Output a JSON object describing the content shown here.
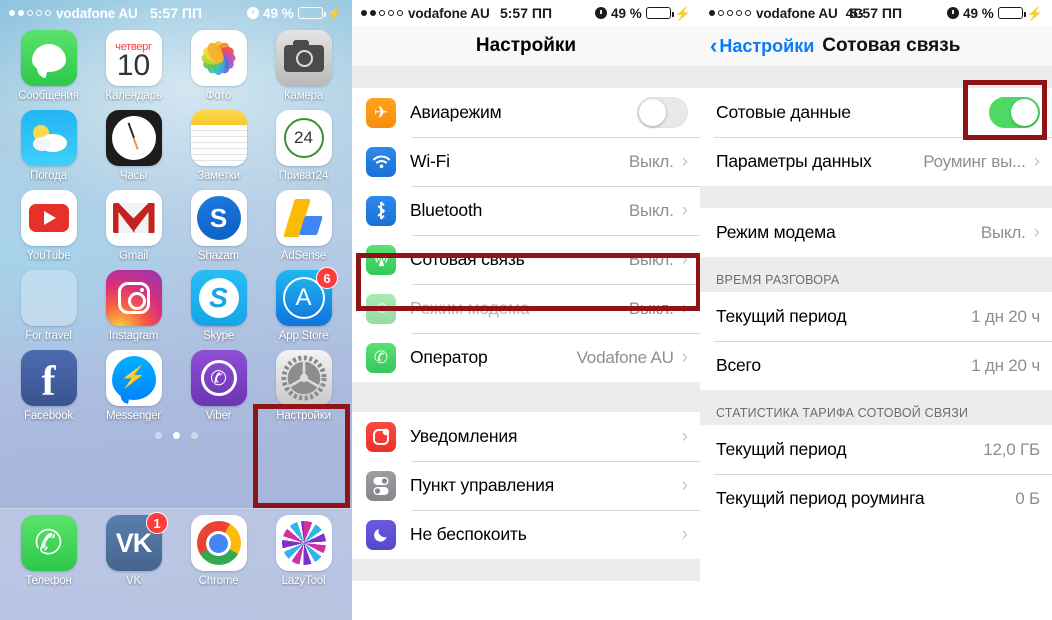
{
  "status_bars": {
    "home": {
      "dots_filled": 2,
      "dots_total": 5,
      "carrier": "vodafone AU",
      "network": "",
      "time": "5:57 ПП",
      "battery_pct": "49 %",
      "charging": true
    },
    "settings": {
      "dots_filled": 2,
      "dots_total": 5,
      "carrier": "vodafone AU",
      "network": "",
      "time": "5:57 ПП",
      "battery_pct": "49 %",
      "charging": true
    },
    "cellular": {
      "dots_filled": 1,
      "dots_total": 5,
      "carrier": "vodafone AU",
      "network": "4G",
      "time": "5:57 ПП",
      "battery_pct": "49 %",
      "charging": true
    }
  },
  "home_screen": {
    "rows": [
      [
        {
          "label": "Сообщения",
          "icon": "messages-icon"
        },
        {
          "label": "Календарь",
          "icon": "calendar-icon",
          "weekday": "четверг",
          "day": "10"
        },
        {
          "label": "Фото",
          "icon": "photos-icon"
        },
        {
          "label": "Камера",
          "icon": "camera-icon"
        }
      ],
      [
        {
          "label": "Погода",
          "icon": "weather-icon"
        },
        {
          "label": "Часы",
          "icon": "clock-icon"
        },
        {
          "label": "Заметки",
          "icon": "notes-icon"
        },
        {
          "label": "Приват24",
          "icon": "privat24-icon",
          "text": "24"
        }
      ],
      [
        {
          "label": "YouTube",
          "icon": "youtube-icon"
        },
        {
          "label": "Gmail",
          "icon": "gmail-icon"
        },
        {
          "label": "Shazam",
          "icon": "shazam-icon",
          "text": "S"
        },
        {
          "label": "AdSense",
          "icon": "adsense-icon"
        }
      ],
      [
        {
          "label": "For travel",
          "icon": "folder-icon"
        },
        {
          "label": "Instagram",
          "icon": "instagram-icon"
        },
        {
          "label": "Skype",
          "icon": "skype-icon",
          "text": "S"
        },
        {
          "label": "App Store",
          "icon": "appstore-icon",
          "badge": "6"
        }
      ],
      [
        {
          "label": "Facebook",
          "icon": "facebook-icon",
          "text": "f"
        },
        {
          "label": "Messenger",
          "icon": "messenger-icon"
        },
        {
          "label": "Viber",
          "icon": "viber-icon"
        },
        {
          "label": "Настройки",
          "icon": "settings-gear-icon",
          "highlighted": true
        }
      ]
    ],
    "page_dots": {
      "count": 3,
      "active_index": 1
    },
    "dock": [
      {
        "label": "Телефон",
        "icon": "phone-icon"
      },
      {
        "label": "VK",
        "icon": "vk-icon",
        "text": "VK",
        "badge": "1"
      },
      {
        "label": "Chrome",
        "icon": "chrome-icon"
      },
      {
        "label": "LazyTool",
        "icon": "lazytool-icon"
      }
    ]
  },
  "settings_screen": {
    "title": "Настройки",
    "group1": [
      {
        "label": "Авиарежим",
        "icon": "airplane-icon",
        "control": "toggle",
        "toggle_on": false
      },
      {
        "label": "Wi-Fi",
        "icon": "wifi-icon",
        "value": "Выкл.",
        "chevron": "›"
      },
      {
        "label": "Bluetooth",
        "icon": "bluetooth-icon",
        "value": "Выкл.",
        "chevron": "›"
      },
      {
        "label": "Сотовая связь",
        "icon": "cellular-icon",
        "value": "Выкл.",
        "chevron": "›",
        "highlighted": true
      },
      {
        "label": "Режим модема",
        "icon": "hotspot-icon",
        "value": "Выкл.",
        "chevron": "›",
        "dimmed": true
      },
      {
        "label": "Оператор",
        "icon": "carrier-phone-icon",
        "value": "Vodafone AU",
        "chevron": "›"
      }
    ],
    "group2": [
      {
        "label": "Уведомления",
        "icon": "notifications-icon",
        "chevron": "›"
      },
      {
        "label": "Пункт управления",
        "icon": "control-center-icon",
        "chevron": "›"
      },
      {
        "label": "Не беспокоить",
        "icon": "do-not-disturb-icon",
        "chevron": "›"
      }
    ]
  },
  "cellular_screen": {
    "back_label": "Настройки",
    "title": "Сотовая связь",
    "group1": [
      {
        "label": "Сотовые данные",
        "control": "toggle",
        "toggle_on": true,
        "highlighted": true
      },
      {
        "label": "Параметры данных",
        "value": "Роуминг вы...",
        "chevron": "›"
      }
    ],
    "group2": [
      {
        "label": "Режим модема",
        "value": "Выкл.",
        "chevron": "›"
      }
    ],
    "section_calltime": {
      "header": "ВРЕМЯ РАЗГОВОРА",
      "rows": [
        {
          "label": "Текущий период",
          "value": "1 дн 20 ч"
        },
        {
          "label": "Всего",
          "value": "1 дн 20 ч"
        }
      ]
    },
    "section_stats": {
      "header": "СТАТИСТИКА ТАРИФА СОТОВОЙ СВЯЗИ",
      "rows": [
        {
          "label": "Текущий период",
          "value": "12,0 ГБ"
        },
        {
          "label": "Текущий период роуминга",
          "value": "0 Б"
        }
      ]
    }
  },
  "colors": {
    "highlight_box": "#8e1417",
    "ios_blue": "#0a7cf3",
    "ios_green": "#4cd964",
    "badge_red": "#fc3d39"
  }
}
